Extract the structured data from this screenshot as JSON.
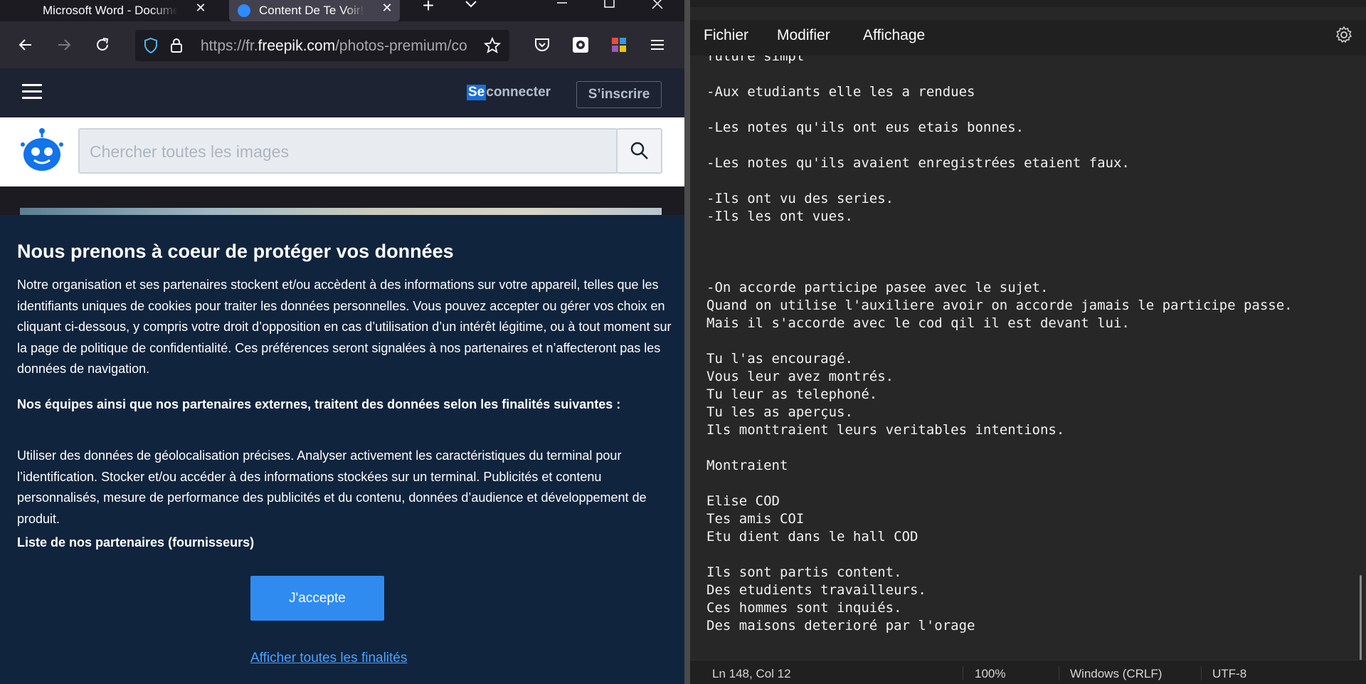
{
  "browser": {
    "tabs": [
      {
        "title": "Microsoft Word - Document",
        "close": "✕"
      },
      {
        "title": "Content De Te Voir! De",
        "close": "✕"
      }
    ],
    "new_tab": "+",
    "url": {
      "prefix": "https://fr.",
      "host": "freepik.com",
      "path": "/photos-premium/co"
    }
  },
  "site": {
    "login_highlight": "Se",
    "login_rest": " connecter",
    "signup": "S’inscrire",
    "search_placeholder": "Chercher toutes les images"
  },
  "consent": {
    "title": "Nous prenons à coeur de protéger vos données",
    "paragraph1": "Notre organisation et ses partenaires stockent et/ou accèdent à des informations sur votre appareil, telles que les identifiants uniques de cookies pour traiter les données personnelles. Vous pouvez accepter ou gérer vos choix en cliquant ci-dessous, y compris votre droit d’opposition en cas d’utilisation d’un intérêt légitime, ou à tout moment sur la page de politique de confidentialité. Ces préférences seront signalées à nos partenaires et n’affecteront pas les données de navigation.",
    "subheading": "Nos équipes ainsi que nos partenaires externes, traitent des données selon les finalités suivantes :",
    "paragraph2": "Utiliser des données de géolocalisation précises. Analyser activement les caractéristiques du terminal pour l’identification. Stocker et/ou accéder à des informations stockées sur un terminal. Publicités et contenu personnalisés, mesure de performance des publicités et du contenu, données d’audience et développement de produit.",
    "partners_link": "Liste de nos partenaires (fournisseurs)",
    "accept_button": "J'accepte",
    "show_all_link": "Afficher toutes les finalités"
  },
  "notepad": {
    "menu": {
      "file": "Fichier",
      "edit": "Modifier",
      "view": "Affichage"
    },
    "content": "future simpl\n\n-Aux etudiants elle les a rendues\n\n-Les notes qu'ils ont eus etais bonnes.\n\n-Les notes qu'ils avaient enregistrées etaient faux.\n\n-Ils ont vu des series.\n-Ils les ont vues.\n\n\n\n-On accorde participe pasee avec le sujet.\nQuand on utilise l'auxiliere avoir on accorde jamais le participe passe.\nMais il s'accorde avec le cod qil il est devant lui.\n\nTu l'as encouragé.\nVous leur avez montrés.\nTu leur as telephoné.\nTu les as aperçus.\nIls monttraient leurs veritables intentions.\n\nMontraient\n\nElise COD\nTes amis COI\nEtu dient dans le hall COD\n\nIls sont partis content.\nDes etudients travailleurs.\nCes hommes sont inquiés.\nDes maisons deterioré par l'orage",
    "status": {
      "position": "Ln 148, Col 12",
      "zoom": "100%",
      "line_ending": "Windows (CRLF)",
      "encoding": "UTF-8"
    }
  }
}
